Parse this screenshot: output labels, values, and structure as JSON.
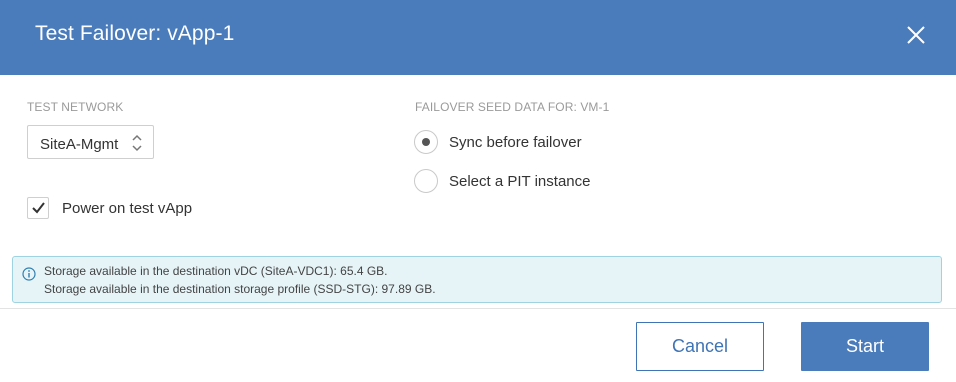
{
  "dialog": {
    "title": "Test Failover: vApp-1",
    "close_icon": "close-icon",
    "header_color": "#4a7cbc"
  },
  "test_network": {
    "label": "TEST NETWORK",
    "selected": "SiteA-Mgmt"
  },
  "power_on": {
    "label": "Power on test vApp",
    "checked": true
  },
  "failover_seed": {
    "label": "FAILOVER SEED DATA FOR: VM-1",
    "options": [
      {
        "label": "Sync before failover",
        "selected": true
      },
      {
        "label": "Select a PIT instance",
        "selected": false
      }
    ]
  },
  "info": {
    "icon": "info-icon",
    "lines": [
      "Storage available in the destination vDC (SiteA-VDC1): 65.4 GB.",
      "Storage available in the destination storage profile (SSD-STG): 97.89 GB."
    ]
  },
  "footer": {
    "cancel_label": "Cancel",
    "start_label": "Start",
    "accent_color": "#3f74b5"
  }
}
